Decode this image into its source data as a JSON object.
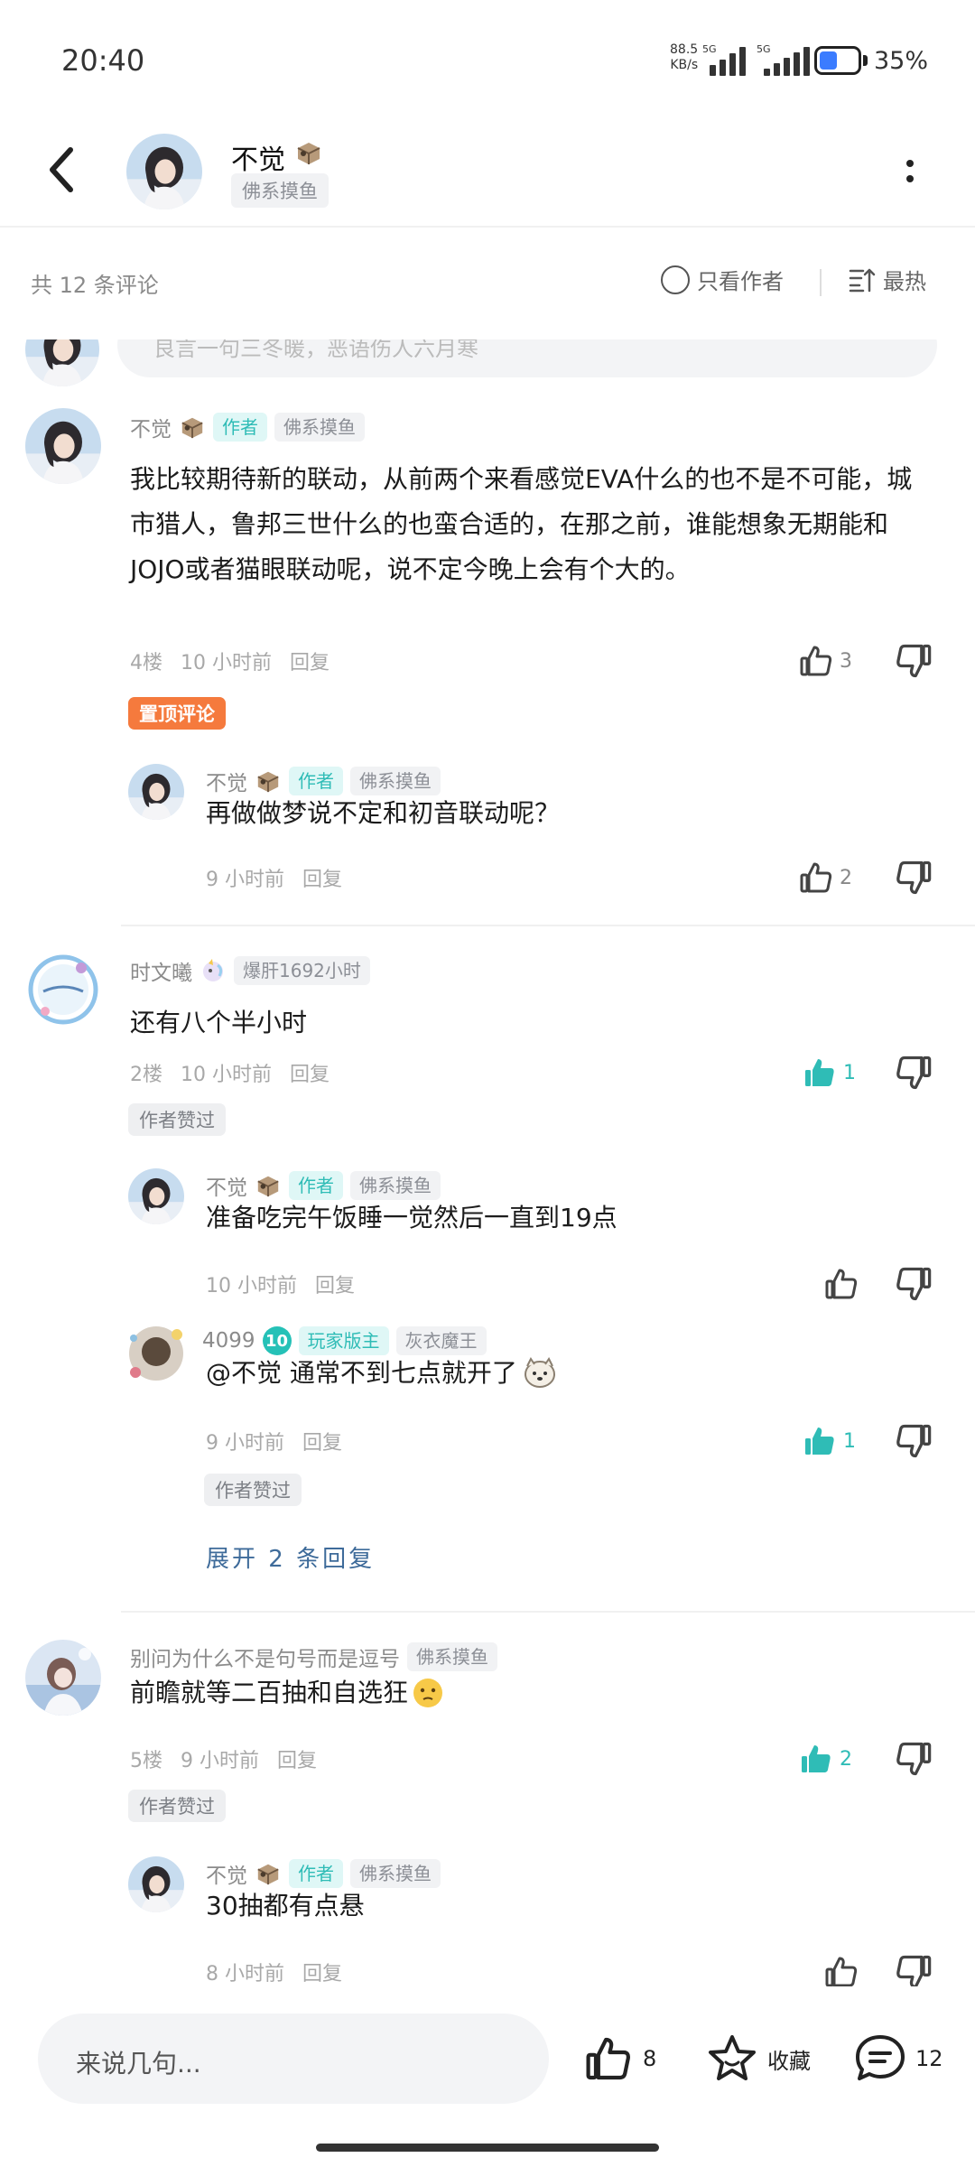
{
  "status_bar": {
    "time": "20:40",
    "net_speed_value": "88.5",
    "net_speed_unit": "KB/s",
    "network_1": "5G",
    "network_2": "5G",
    "battery_percent": "35%"
  },
  "header": {
    "user_name": "不觉",
    "user_tag": "佛系摸鱼"
  },
  "filter_bar": {
    "comment_count": "共 12 条评论",
    "only_author_label": "只看作者",
    "sort_label": "最热"
  },
  "previous_reply_placeholder": "良言一句三冬暖，恶语伤人六月寒",
  "comments": [
    {
      "user": "不觉",
      "author_tag": "作者",
      "user_tag": "佛系摸鱼",
      "text": "我比较期待新的联动，从前两个来看感觉EVA什么的也不是不可能，城市猎人，鲁邦三世什么的也蛮合适的，在那之前，谁能想象无期能和JOJO或者猫眼联动呢，说不定今晚上会有个大的。",
      "floor": "4楼",
      "time": "10 小时前",
      "reply_label": "回复",
      "likes": "3",
      "pinned_label": "置顶评论",
      "replies": [
        {
          "user": "不觉",
          "author_tag": "作者",
          "user_tag": "佛系摸鱼",
          "text": "再做做梦说不定和初音联动呢？",
          "time": "9 小时前",
          "reply_label": "回复",
          "likes": "2"
        }
      ]
    },
    {
      "user": "时文曦",
      "user_tag": "爆肝1692小时",
      "text": "还有八个半小时",
      "floor": "2楼",
      "time": "10 小时前",
      "reply_label": "回复",
      "likes": "1",
      "liked": true,
      "author_liked_label": "作者赞过",
      "replies": [
        {
          "user": "不觉",
          "author_tag": "作者",
          "user_tag": "佛系摸鱼",
          "text": "准备吃完午饭睡一觉然后一直到19点",
          "time": "10 小时前",
          "reply_label": "回复",
          "likes": ""
        },
        {
          "user": "4099",
          "level": "10",
          "role_tag": "玩家版主",
          "user_tag": "灰衣魔王",
          "text": "@不觉  通常不到七点就开了",
          "time": "9 小时前",
          "reply_label": "回复",
          "likes": "1",
          "liked": true,
          "author_liked_label": "作者赞过"
        }
      ],
      "expand_label": "展开 2 条回复"
    },
    {
      "user": "别问为什么不是句号而是逗号",
      "user_tag": "佛系摸鱼",
      "text": "前瞻就等二百抽和自选狂",
      "floor": "5楼",
      "time": "9 小时前",
      "reply_label": "回复",
      "likes": "2",
      "liked": true,
      "author_liked_label": "作者赞过",
      "replies": [
        {
          "user": "不觉",
          "author_tag": "作者",
          "user_tag": "佛系摸鱼",
          "text": "30抽都有点悬",
          "time": "8 小时前",
          "reply_label": "回复",
          "likes": ""
        }
      ]
    }
  ],
  "bottom_bar": {
    "input_placeholder": "来说几句...",
    "like_count": "8",
    "favorite_label": "收藏",
    "comment_count": "12"
  },
  "colors": {
    "accent_teal": "#2fbcb6",
    "pinned_orange": "#f57a3d",
    "link_blue": "#3e6b9a"
  }
}
